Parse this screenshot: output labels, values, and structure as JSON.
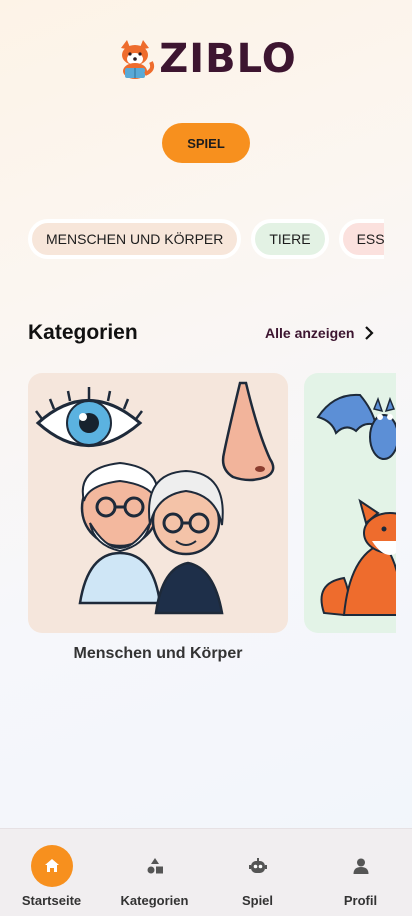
{
  "app": {
    "logo_text": "ZIBLO",
    "logo_icon": "fox-reading-icon"
  },
  "play_button": {
    "label": "SPIEL"
  },
  "chips": [
    {
      "label": "MENSCHEN UND KÖRPER",
      "color": "#f7e6da"
    },
    {
      "label": "TIERE",
      "color": "#e3f2e4"
    },
    {
      "label": "ESSEN",
      "color": "#fbe1de"
    }
  ],
  "categories_section": {
    "title": "Kategorien",
    "see_all_label": "Alle anzeigen",
    "cards": [
      {
        "label": "Menschen und Körper",
        "color": "#f5e6dc"
      },
      {
        "label": "",
        "color": "#e3f3e7"
      }
    ]
  },
  "bottom_nav": {
    "accent": "#f7901e",
    "items": [
      {
        "label": "Startseite",
        "icon": "home-icon",
        "active": true
      },
      {
        "label": "Kategorien",
        "icon": "shapes-icon",
        "active": false
      },
      {
        "label": "Spiel",
        "icon": "robot-icon",
        "active": false
      },
      {
        "label": "Profil",
        "icon": "person-icon",
        "active": false
      }
    ]
  }
}
